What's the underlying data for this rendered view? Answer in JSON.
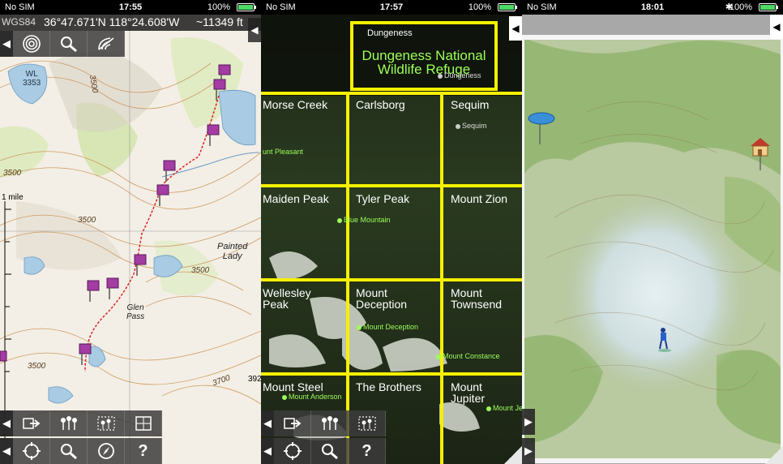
{
  "panel1": {
    "status": {
      "carrier": "No SIM",
      "time": "17:55",
      "battery": "100%"
    },
    "coords": {
      "datum": "WGS84",
      "position": "36°47.671'N 118°24.608'W",
      "elevation": "~11349 ft"
    },
    "labels": {
      "lake": "WL\n3353",
      "painted_lady": "Painted\nLady",
      "glen_pass": "Glen\nPass",
      "scale": "1 mile",
      "contour_3500a": "3500",
      "contour_3500b": "3500",
      "contour_3500c": "3500",
      "contour_3500d": "3500",
      "contour_3500e": "3500",
      "contour_3700": "3700",
      "edge_392": "392"
    },
    "icons": {
      "tracks": "track-icon",
      "search": "search-icon",
      "wifi": "satellite-signal-icon",
      "export": "export-icon",
      "waypoints": "waypoints-icon",
      "waypoint_edit": "waypoint-edit-icon",
      "map_crop": "map-crop-icon",
      "locate": "locate-icon",
      "magnify": "magnify-icon",
      "compass": "compass-icon",
      "help": "help-icon"
    }
  },
  "panel2": {
    "status": {
      "carrier": "No SIM",
      "time": "17:57",
      "battery": "100%"
    },
    "top_cell": {
      "title": "Dungeness",
      "name": "Dungeness National\nWildlife Refuge",
      "poi": "Dungeness"
    },
    "cells": [
      {
        "name": "Morse Creek"
      },
      {
        "name": "Carlsborg"
      },
      {
        "name": "Sequim"
      },
      {
        "name": "Maiden Peak"
      },
      {
        "name": "Tyler Peak"
      },
      {
        "name": "Mount Zion"
      },
      {
        "name": "Wellesley\nPeak"
      },
      {
        "name": "Mount\nDeception"
      },
      {
        "name": "Mount\nTownsend"
      },
      {
        "name": "Mount Steel"
      },
      {
        "name": "The Brothers"
      },
      {
        "name": "Mount\nJupiter"
      }
    ],
    "pois": {
      "mount_pleasant": "unt Pleasant",
      "sequim": "Sequim",
      "blue_mountain": "Blue Mountain",
      "mount_deception": "Mount Deception",
      "mount_constance": "Mount Constance",
      "mount_anderson": "Mount Anderson",
      "mount_je": "Mount Je"
    }
  },
  "panel3": {
    "status": {
      "carrier": "No SIM",
      "time": "18:01",
      "battery": "100%"
    }
  },
  "colors": {
    "grid": "#f5f000",
    "poi": "#9cff5a",
    "trail": "#d22",
    "pin": "#a33ca3"
  }
}
